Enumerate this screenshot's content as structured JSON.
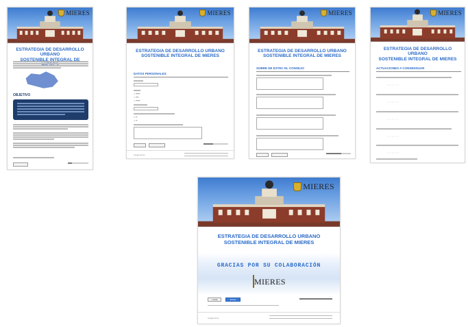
{
  "brand": {
    "logo_text": "MIERES"
  },
  "survey": {
    "title_line1": "ESTRATEGIA DE DESARROLLO URBANO",
    "title_line2": "SOSTENIBLE INTEGRAL DE MIERES"
  },
  "page1": {
    "section": "OBJETIVO"
  },
  "page2": {
    "section": "DATOS PERSONALES"
  },
  "page3": {
    "section": "SOBRE DE ESTEC EL CONSEJO"
  },
  "page4": {
    "section": "ACTUACIONES A CONSENSUAR"
  },
  "page5": {
    "thanks": "GRACIAS POR SU COLABORACIÓN",
    "back_label": "« Atrás",
    "send_label": "Enviar"
  },
  "footer": {
    "brand": "Google Forms"
  }
}
